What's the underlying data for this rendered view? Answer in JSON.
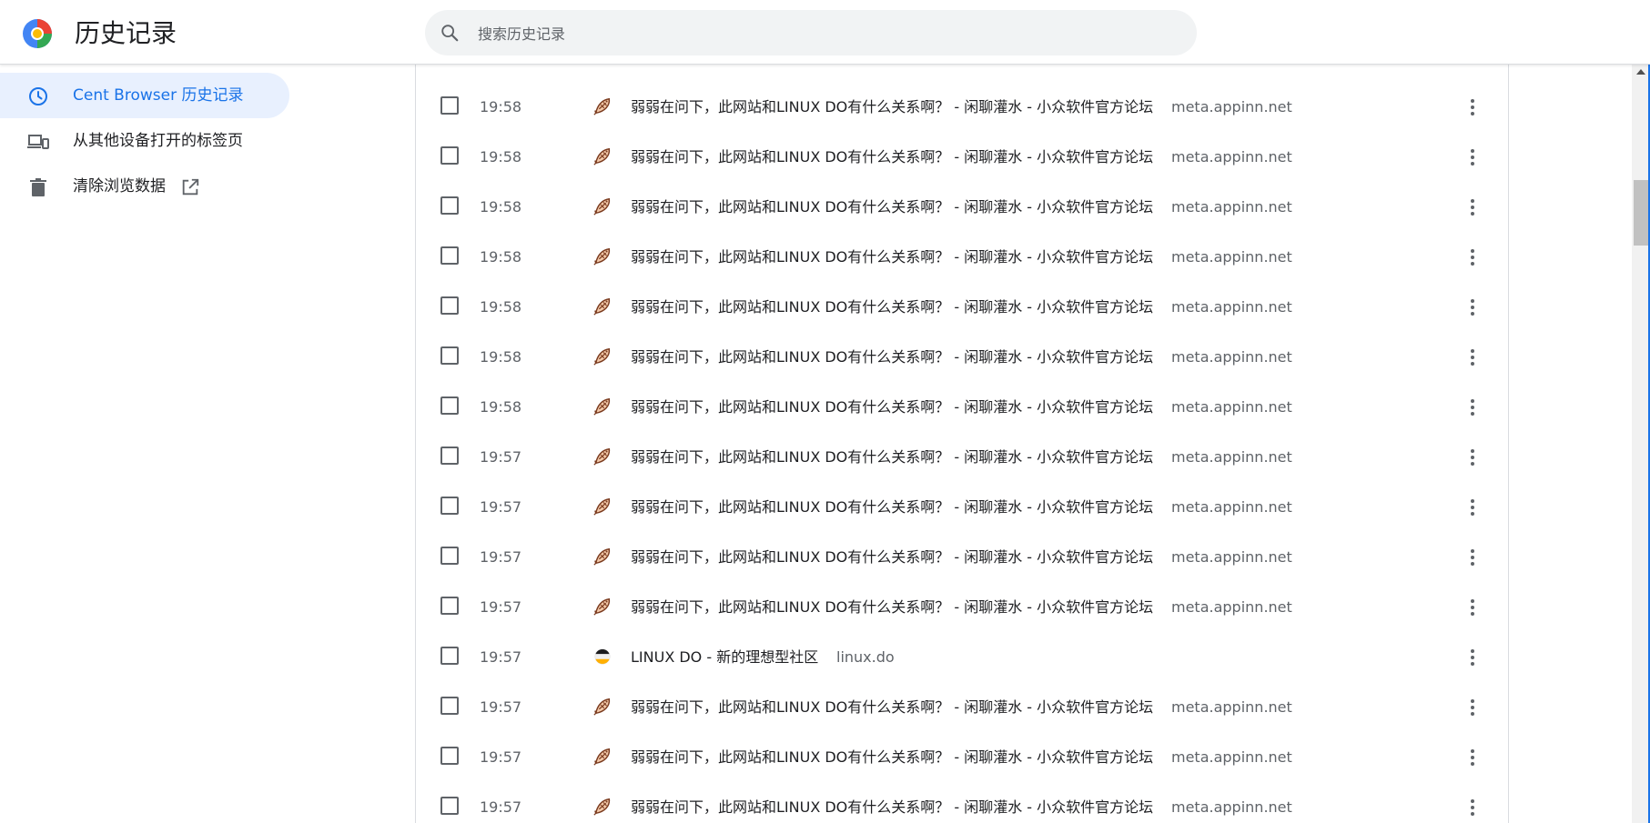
{
  "header": {
    "title": "历史记录",
    "search_placeholder": "搜索历史记录"
  },
  "sidebar": {
    "items": [
      {
        "label": "Cent Browser 历史记录",
        "icon": "clock-icon",
        "active": true
      },
      {
        "label": "从其他设备打开的标签页",
        "icon": "devices-icon",
        "active": false
      },
      {
        "label": "清除浏览数据",
        "icon": "trash-icon",
        "active": false
      }
    ]
  },
  "history": {
    "rows": [
      {
        "time": "19:58",
        "title": "弱弱在问下，此网站和LINUX DO有什么关系啊？ - 闲聊灌水 - 小众软件官方论坛",
        "domain": "meta.appinn.net",
        "favicon": "fish-icon"
      },
      {
        "time": "19:58",
        "title": "弱弱在问下，此网站和LINUX DO有什么关系啊？ - 闲聊灌水 - 小众软件官方论坛",
        "domain": "meta.appinn.net",
        "favicon": "fish-icon"
      },
      {
        "time": "19:58",
        "title": "弱弱在问下，此网站和LINUX DO有什么关系啊？ - 闲聊灌水 - 小众软件官方论坛",
        "domain": "meta.appinn.net",
        "favicon": "fish-icon"
      },
      {
        "time": "19:58",
        "title": "弱弱在问下，此网站和LINUX DO有什么关系啊？ - 闲聊灌水 - 小众软件官方论坛",
        "domain": "meta.appinn.net",
        "favicon": "fish-icon"
      },
      {
        "time": "19:58",
        "title": "弱弱在问下，此网站和LINUX DO有什么关系啊？ - 闲聊灌水 - 小众软件官方论坛",
        "domain": "meta.appinn.net",
        "favicon": "fish-icon"
      },
      {
        "time": "19:58",
        "title": "弱弱在问下，此网站和LINUX DO有什么关系啊？ - 闲聊灌水 - 小众软件官方论坛",
        "domain": "meta.appinn.net",
        "favicon": "fish-icon"
      },
      {
        "time": "19:58",
        "title": "弱弱在问下，此网站和LINUX DO有什么关系啊？ - 闲聊灌水 - 小众软件官方论坛",
        "domain": "meta.appinn.net",
        "favicon": "fish-icon"
      },
      {
        "time": "19:57",
        "title": "弱弱在问下，此网站和LINUX DO有什么关系啊？ - 闲聊灌水 - 小众软件官方论坛",
        "domain": "meta.appinn.net",
        "favicon": "fish-icon"
      },
      {
        "time": "19:57",
        "title": "弱弱在问下，此网站和LINUX DO有什么关系啊？ - 闲聊灌水 - 小众软件官方论坛",
        "domain": "meta.appinn.net",
        "favicon": "fish-icon"
      },
      {
        "time": "19:57",
        "title": "弱弱在问下，此网站和LINUX DO有什么关系啊？ - 闲聊灌水 - 小众软件官方论坛",
        "domain": "meta.appinn.net",
        "favicon": "fish-icon"
      },
      {
        "time": "19:57",
        "title": "弱弱在问下，此网站和LINUX DO有什么关系啊？ - 闲聊灌水 - 小众软件官方论坛",
        "domain": "meta.appinn.net",
        "favicon": "fish-icon"
      },
      {
        "time": "19:57",
        "title": "LINUX DO - 新的理想型社区",
        "domain": "linux.do",
        "favicon": "linuxdo-icon"
      },
      {
        "time": "19:57",
        "title": "弱弱在问下，此网站和LINUX DO有什么关系啊？ - 闲聊灌水 - 小众软件官方论坛",
        "domain": "meta.appinn.net",
        "favicon": "fish-icon"
      },
      {
        "time": "19:57",
        "title": "弱弱在问下，此网站和LINUX DO有什么关系啊？ - 闲聊灌水 - 小众软件官方论坛",
        "domain": "meta.appinn.net",
        "favicon": "fish-icon"
      },
      {
        "time": "19:57",
        "title": "弱弱在问下，此网站和LINUX DO有什么关系啊？ - 闲聊灌水 - 小众软件官方论坛",
        "domain": "meta.appinn.net",
        "favicon": "fish-icon"
      }
    ]
  },
  "colors": {
    "accent": "#1a73e8",
    "active_bg": "#e8f0fe",
    "secondary_text": "#5f6368"
  }
}
